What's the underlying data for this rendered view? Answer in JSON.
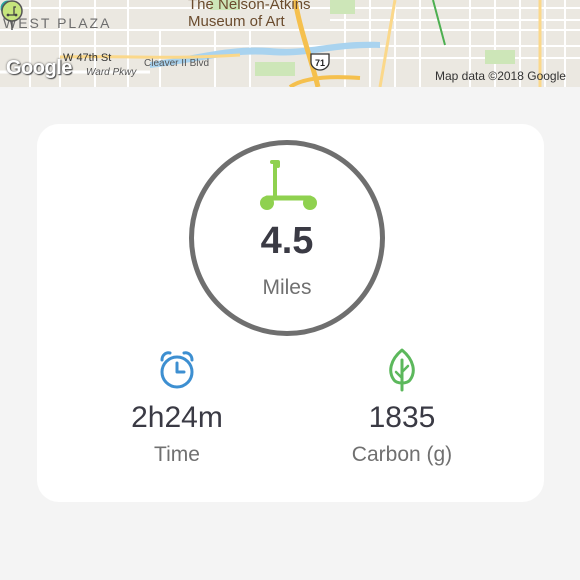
{
  "map": {
    "labels": {
      "west_plaza": "WEST PLAZA",
      "museum_line1": "The Nelson-Atkins",
      "museum_line2": "Museum of Art",
      "w47th": "W 47th St",
      "ward_pkwy": "Ward Pkwy",
      "cleaver": "Cleaver II Blvd",
      "highway": "71"
    },
    "google_logo": "Google",
    "attribution": "Map data ©2018 Google"
  },
  "ride_summary": {
    "distance_value": "4.5",
    "distance_unit": "Miles",
    "time_value": "2h24m",
    "time_label": "Time",
    "carbon_value": "1835",
    "carbon_label": "Carbon (g)"
  },
  "icons": {
    "scooter": "scooter-icon",
    "clock": "alarm-clock-icon",
    "leaf": "leaf-icon"
  },
  "colors": {
    "scooter_green": "#8fd14f",
    "clock_blue": "#3d8fd1",
    "leaf_green": "#5cb85c",
    "ring_gray": "#6f6f6f",
    "text_dark": "#3a3a44",
    "text_muted": "#707070"
  }
}
